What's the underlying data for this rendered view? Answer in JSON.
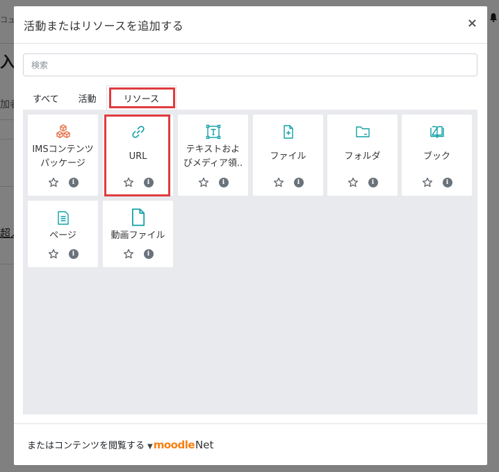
{
  "background": {
    "top_fragment": "コュア",
    "heading_fragment": "入",
    "label_fragment": "加者",
    "link_fragment": "超入"
  },
  "modal": {
    "title": "活動またはリソースを追加する",
    "close_label": "×",
    "search_placeholder": "検索",
    "tabs": [
      {
        "label": "すべて",
        "active": false
      },
      {
        "label": "活動",
        "active": false
      },
      {
        "label": "リソース",
        "active": true
      }
    ],
    "items": [
      {
        "label_lines": [
          "IMSコンテンツ",
          "パッケージ"
        ],
        "icon": "ims-package-icon",
        "icon_color": "#e4704a",
        "highlighted": false
      },
      {
        "label_lines": [
          "URL"
        ],
        "icon": "link-icon",
        "icon_color": "#0f9fa6",
        "highlighted": true
      },
      {
        "label_lines": [
          "テキストおよ",
          "びメディア領.."
        ],
        "icon": "text-media-icon",
        "icon_color": "#0f9fa6",
        "highlighted": false
      },
      {
        "label_lines": [
          "ファイル"
        ],
        "icon": "file-icon",
        "icon_color": "#0f9fa6",
        "highlighted": false
      },
      {
        "label_lines": [
          "フォルダ"
        ],
        "icon": "folder-icon",
        "icon_color": "#0f9fa6",
        "highlighted": false
      },
      {
        "label_lines": [
          "ブック"
        ],
        "icon": "book-icon",
        "icon_color": "#0f9fa6",
        "highlighted": false
      },
      {
        "label_lines": [
          "ページ"
        ],
        "icon": "page-icon",
        "icon_color": "#0f9fa6",
        "highlighted": false
      },
      {
        "label_lines": [
          "動画ファイル"
        ],
        "icon": "video-file-icon",
        "icon_color": "#0f9fa6",
        "highlighted": false
      }
    ],
    "info_glyph": "i",
    "footer": {
      "text": "またはコンテンツを閲覧する",
      "logo_moodle": "moodle",
      "logo_net": "Net"
    }
  },
  "colors": {
    "highlight": "#e03a3e",
    "resource_icon": "#0f9fa6",
    "ims_icon": "#e4704a",
    "moodle_orange": "#f98012"
  }
}
